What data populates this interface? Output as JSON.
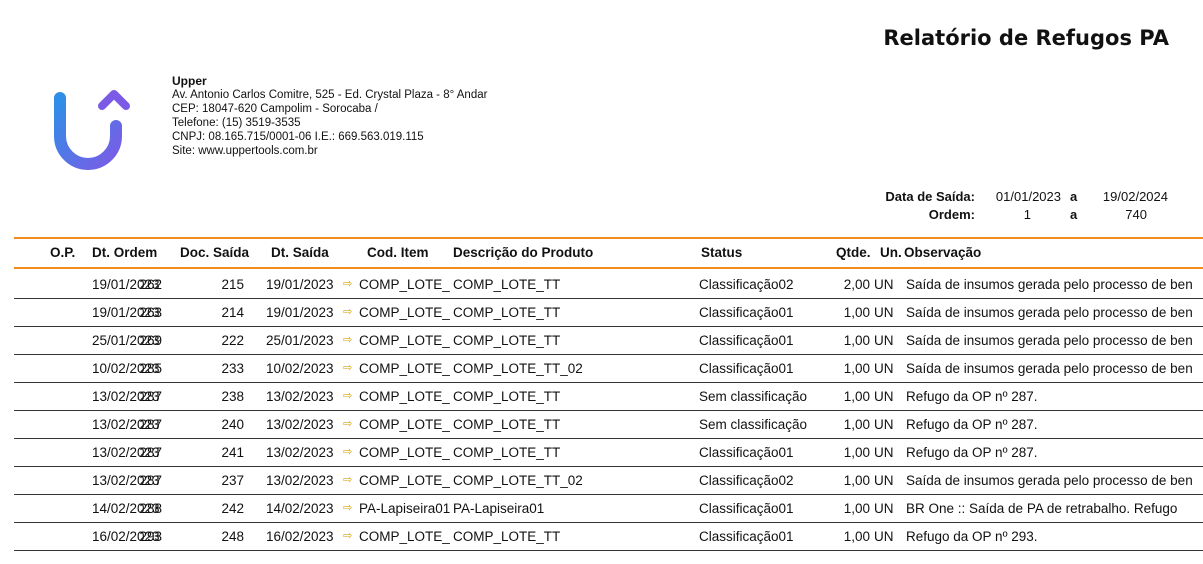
{
  "report": {
    "title": "Relatório de Refugos PA"
  },
  "company": {
    "name": "Upper",
    "address": " Av. Antonio Carlos Comitre, 525 - Ed. Crystal Plaza - 8° Andar",
    "cep": "CEP: 18047-620 Campolim - Sorocaba /",
    "phone": "Telefone: (15) 3519-3535",
    "cnpj": "CNPJ:  08.165.715/0001-06   I.E.:  669.563.019.115",
    "site": "Site: www.uppertools.com.br",
    "logo_colors": {
      "start": "#2f8fe6",
      "end": "#7b5be6"
    }
  },
  "filters": {
    "date_label": "Data de Saída:",
    "date_from": "01/01/2023",
    "date_sep": "a",
    "date_to": "19/02/2024",
    "order_label": "Ordem:",
    "order_from": "1",
    "order_sep": "a",
    "order_to": "740"
  },
  "accent_color": "#f28c1e",
  "table": {
    "headers": {
      "op": "O.P.",
      "dt_ordem": "Dt. Ordem",
      "doc_saida": "Doc. Saída",
      "dt_saida": "Dt. Saída",
      "cod_item": "Cod. Item",
      "descricao": "Descrição do Produto",
      "status": "Status",
      "qtde": "Qtde.",
      "un": "Un.",
      "obs": "Observação"
    },
    "rows": [
      {
        "op": "262",
        "dt_ordem": "19/01/2023",
        "doc": "215",
        "dt_saida": "19/01/2023",
        "cod": "COMP_LOTE_TT",
        "desc": "COMP_LOTE_TT",
        "status": "Classificação02",
        "qtde": "2,00",
        "un": "UN",
        "obs": "Saída de insumos gerada pelo processo de beneficiamento"
      },
      {
        "op": "263",
        "dt_ordem": "19/01/2023",
        "doc": "214",
        "dt_saida": "19/01/2023",
        "cod": "COMP_LOTE_TT",
        "desc": "COMP_LOTE_TT",
        "status": "Classificação01",
        "qtde": "1,00",
        "un": "UN",
        "obs": "Saída de insumos gerada pelo processo de beneficiamento"
      },
      {
        "op": "269",
        "dt_ordem": "25/01/2023",
        "doc": "222",
        "dt_saida": "25/01/2023",
        "cod": "COMP_LOTE_TT",
        "desc": "COMP_LOTE_TT",
        "status": "Classificação01",
        "qtde": "1,00",
        "un": "UN",
        "obs": "Saída de insumos gerada pelo processo de beneficiamento"
      },
      {
        "op": "285",
        "dt_ordem": "10/02/2023",
        "doc": "233",
        "dt_saida": "10/02/2023",
        "cod": "COMP_LOTE_TT",
        "desc": "COMP_LOTE_TT_02",
        "status": "Classificação01",
        "qtde": "1,00",
        "un": "UN",
        "obs": "Saída de insumos gerada pelo processo de beneficiamento"
      },
      {
        "op": "287",
        "dt_ordem": "13/02/2023",
        "doc": "238",
        "dt_saida": "13/02/2023",
        "cod": "COMP_LOTE_TT",
        "desc": "COMP_LOTE_TT",
        "status": "Sem classificação",
        "qtde": "1,00",
        "un": "UN",
        "obs": "Refugo da OP nº 287."
      },
      {
        "op": "287",
        "dt_ordem": "13/02/2023",
        "doc": "240",
        "dt_saida": "13/02/2023",
        "cod": "COMP_LOTE_TT",
        "desc": "COMP_LOTE_TT",
        "status": "Sem classificação",
        "qtde": "1,00",
        "un": "UN",
        "obs": "Refugo da OP nº 287."
      },
      {
        "op": "287",
        "dt_ordem": "13/02/2023",
        "doc": "241",
        "dt_saida": "13/02/2023",
        "cod": "COMP_LOTE_TT",
        "desc": "COMP_LOTE_TT",
        "status": "Classificação01",
        "qtde": "1,00",
        "un": "UN",
        "obs": "Refugo da OP nº 287."
      },
      {
        "op": "287",
        "dt_ordem": "13/02/2023",
        "doc": "237",
        "dt_saida": "13/02/2023",
        "cod": "COMP_LOTE_TT",
        "desc": "COMP_LOTE_TT_02",
        "status": "Classificação02",
        "qtde": "1,00",
        "un": "UN",
        "obs": "Saída de insumos gerada pelo processo de beneficiamento"
      },
      {
        "op": "288",
        "dt_ordem": "14/02/2023",
        "doc": "242",
        "dt_saida": "14/02/2023",
        "cod": "PA-Lapiseira01",
        "desc": "PA-Lapiseira01",
        "status": "Classificação01",
        "qtde": "1,00",
        "un": "UN",
        "obs": "BR One :: Saída de PA de retrabalho. Refugo"
      },
      {
        "op": "293",
        "dt_ordem": "16/02/2023",
        "doc": "248",
        "dt_saida": "16/02/2023",
        "cod": "COMP_LOTE_TT",
        "desc": "COMP_LOTE_TT",
        "status": "Classificação01",
        "qtde": "1,00",
        "un": "UN",
        "obs": "Refugo da OP nº 293."
      }
    ]
  }
}
